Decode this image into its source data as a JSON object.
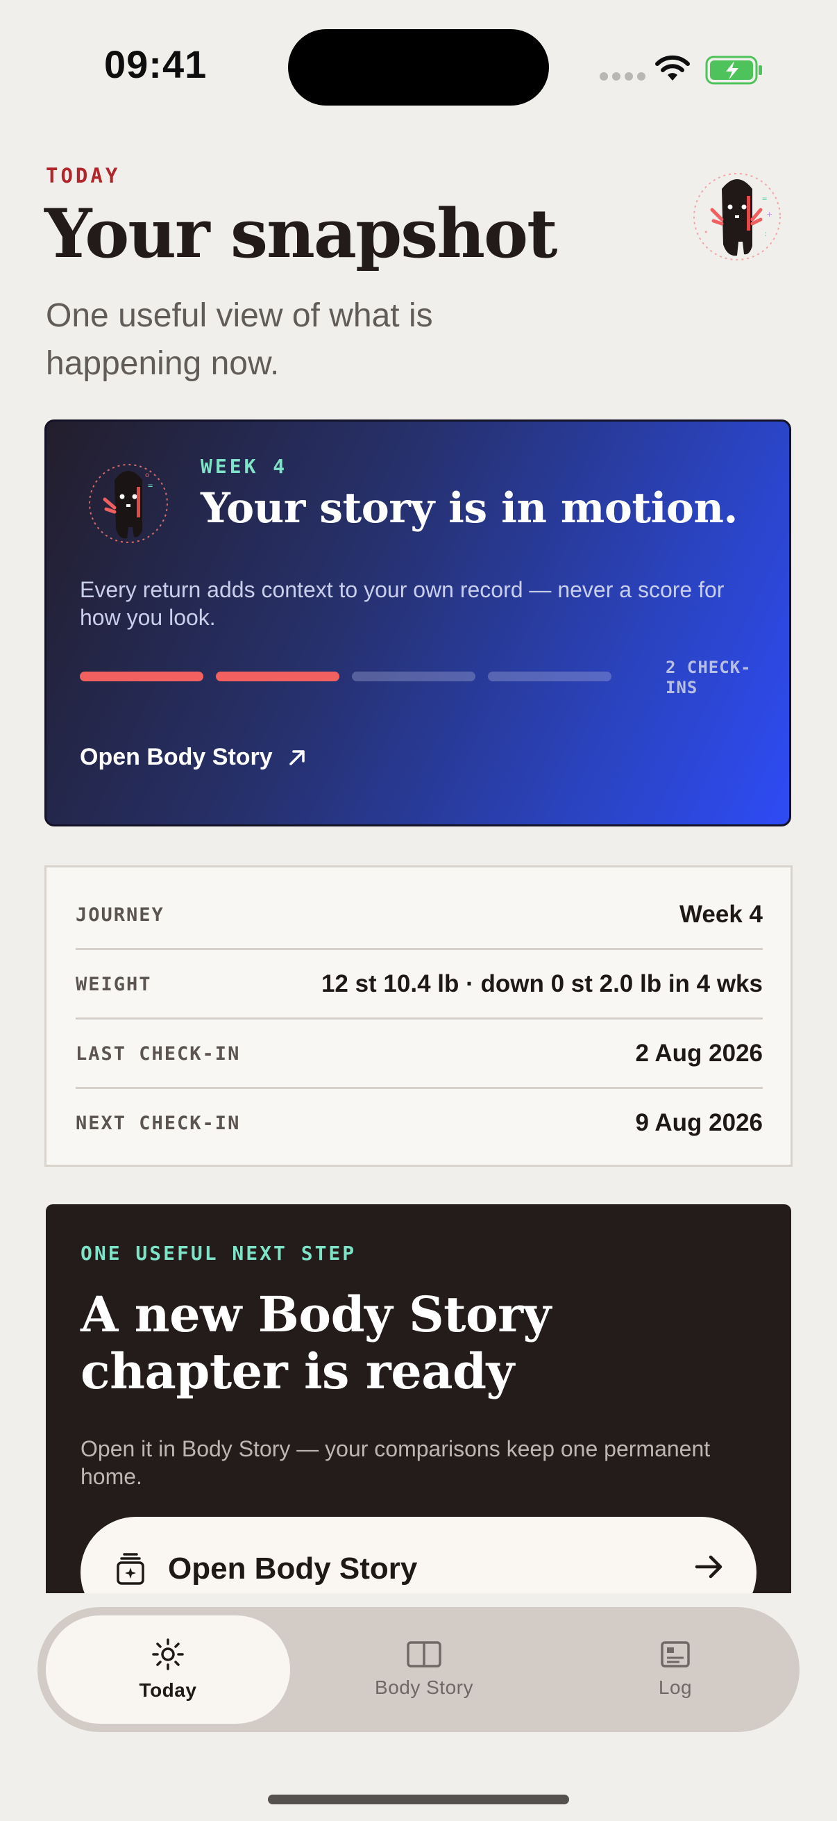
{
  "status_bar": {
    "time": "09:41"
  },
  "header": {
    "eyebrow": "TODAY",
    "title": "Your snapshot",
    "subtitle": "One useful view of what is happening now."
  },
  "hero_card": {
    "eyebrow": "WEEK 4",
    "title": "Your story is in motion.",
    "body": "Every return adds context to your own record — never a score for how you look.",
    "progress": {
      "total_segments": 4,
      "filled_segments": 2
    },
    "count_label": "2 CHECK-INS",
    "link_label": "Open Body Story",
    "colors": {
      "accent": "#F26060",
      "eyebrow": "#7EE3C7"
    }
  },
  "summary": {
    "rows": [
      {
        "label": "JOURNEY",
        "value": "Week 4"
      },
      {
        "label": "WEIGHT",
        "value": "12 st 10.4 lb · down 0 st 2.0 lb in 4 wks"
      },
      {
        "label": "LAST CHECK-IN",
        "value": "2 Aug 2026"
      },
      {
        "label": "NEXT CHECK-IN",
        "value": "9 Aug 2026"
      }
    ]
  },
  "next_step": {
    "eyebrow": "ONE USEFUL NEXT STEP",
    "title": "A new Body Story chapter is ready",
    "body": "Open it in Body Story — your comparisons keep one permanent home.",
    "button_label": "Open Body Story",
    "button_icon": "story-stack-icon"
  },
  "tab_bar": {
    "tabs": [
      {
        "label": "Today",
        "icon": "sun-icon",
        "active": true
      },
      {
        "label": "Body Story",
        "icon": "split-panel-icon",
        "active": false
      },
      {
        "label": "Log",
        "icon": "log-card-icon",
        "active": false
      }
    ]
  }
}
